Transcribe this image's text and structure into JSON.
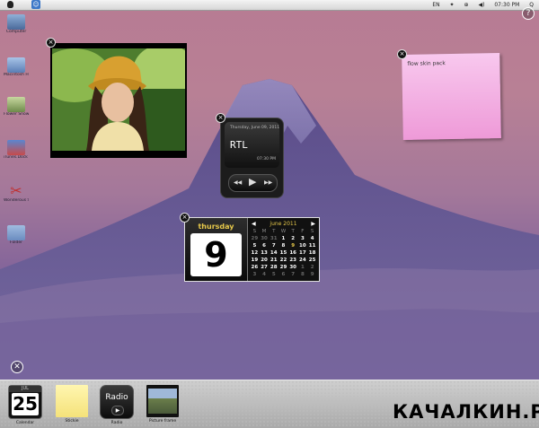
{
  "menubar": {
    "status_items": [
      "EN",
      "✦",
      "⊕",
      "◀)",
      "07:30 PM",
      "Q"
    ]
  },
  "desktop_icons": [
    {
      "label": "Computer",
      "color": "#5f7fb0"
    },
    {
      "label": "Macintosh HD",
      "color": "#6a8fc0"
    },
    {
      "label": "Flower Snow",
      "color": "#8aa06a"
    },
    {
      "label": "iTunes.Dock Shortcut",
      "color": "#b04848"
    },
    {
      "label": "Wonderous Shell",
      "color": "#c03a3a"
    },
    {
      "label": "Folder",
      "color": "#7898c0"
    }
  ],
  "radio_widget": {
    "date": "Thursday, June 09, 2011",
    "station": "RTL",
    "time": "07:30 PM",
    "prev_icon": "◀◀",
    "play_icon": "▶",
    "next_icon": "▶▶"
  },
  "sticky_note": {
    "text": "flow skin pack"
  },
  "calendar": {
    "weekday": "thursday",
    "day": "9",
    "month_title": "june 2011",
    "prev_icon": "◀",
    "next_icon": "▶",
    "dow": [
      "S",
      "M",
      "T",
      "W",
      "T",
      "F",
      "S"
    ],
    "weeks": [
      [
        "29",
        "30",
        "31",
        "1",
        "2",
        "3",
        "4"
      ],
      [
        "5",
        "6",
        "7",
        "8",
        "9",
        "10",
        "11"
      ],
      [
        "12",
        "13",
        "14",
        "15",
        "16",
        "17",
        "18"
      ],
      [
        "19",
        "20",
        "21",
        "22",
        "23",
        "24",
        "25"
      ],
      [
        "26",
        "27",
        "28",
        "29",
        "30",
        "1",
        "2"
      ],
      [
        "3",
        "4",
        "5",
        "6",
        "7",
        "8",
        "9"
      ]
    ]
  },
  "dashboard": {
    "close_icon": "✕",
    "widgets": [
      {
        "label": "Calendar",
        "icon": "calendar-icon",
        "icon_text": "25",
        "icon_top": "JUL"
      },
      {
        "label": "Stickie",
        "icon": "sticky-note-icon"
      },
      {
        "label": "Radio",
        "icon": "radio-icon",
        "icon_text": "Radio"
      },
      {
        "label": "Picture frame",
        "icon": "picture-frame-icon"
      }
    ]
  },
  "help_icon": "?",
  "widget_close_icon": "×",
  "watermark": "КАЧАЛКИН.РУ",
  "colors": {
    "accent_yellow": "#e6c84a",
    "note_pink": "#f4b6e6"
  }
}
